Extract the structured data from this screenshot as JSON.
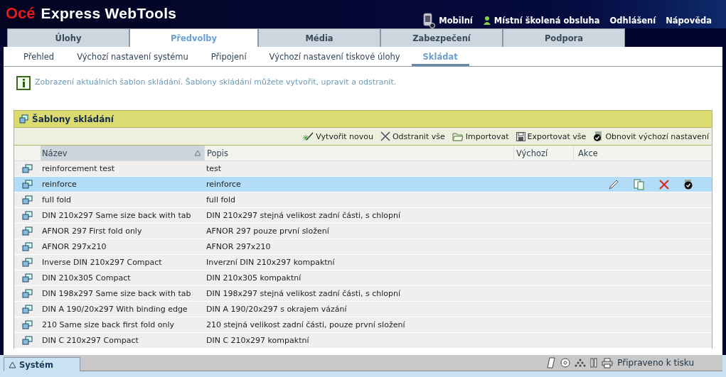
{
  "app": {
    "brand": "Océ",
    "title": "Express WebTools"
  },
  "header_links": [
    {
      "label": "Mobilní",
      "kind": "mobile"
    },
    {
      "label": "Místní školená obsluha",
      "kind": "user"
    },
    {
      "label": "Odhlášení",
      "kind": "plain"
    },
    {
      "label": "Nápověda",
      "kind": "plain"
    }
  ],
  "tabs": [
    {
      "label": "Úlohy",
      "selected": false
    },
    {
      "label": "Předvolby",
      "selected": true
    },
    {
      "label": "Média",
      "selected": false
    },
    {
      "label": "Zabezpečení",
      "selected": false
    },
    {
      "label": "Podpora",
      "selected": false
    }
  ],
  "subtabs": [
    {
      "label": "Přehled",
      "selected": false
    },
    {
      "label": "Výchozí nastavení systému",
      "selected": false
    },
    {
      "label": "Připojení",
      "selected": false
    },
    {
      "label": "Výchozí nastavení tiskové úlohy",
      "selected": false
    },
    {
      "label": "Skládat",
      "selected": true
    }
  ],
  "info": "Zobrazení aktuálních šablon skládání. Šablony skládání můžete vytvořit, upravit a odstranit.",
  "panel": {
    "title": "Šablony skládání",
    "toolbar": [
      {
        "label": "Vytvořit novou",
        "kind": "new"
      },
      {
        "label": "Odstranit vše",
        "kind": "delete"
      },
      {
        "label": "Importovat",
        "kind": "import"
      },
      {
        "label": "Exportovat vše",
        "kind": "export"
      },
      {
        "label": "Obnovit výchozí nastavení",
        "kind": "restore"
      }
    ],
    "columns": [
      "Název",
      "Popis",
      "Výchozí",
      "Akce"
    ],
    "rows": [
      {
        "name": "reinforcement test",
        "description": "test",
        "selected": false
      },
      {
        "name": "reinforce",
        "description": "reinforce",
        "selected": true
      },
      {
        "name": "full fold",
        "description": "full fold",
        "selected": false
      },
      {
        "name": "DIN 210x297 Same size back with tab",
        "description": "DIN 210x297 stejná velikost zadní části, s chlopní",
        "selected": false
      },
      {
        "name": "AFNOR 297 First fold only",
        "description": "AFNOR 297 pouze první složení",
        "selected": false
      },
      {
        "name": "AFNOR 297x210",
        "description": "AFNOR 297x210",
        "selected": false
      },
      {
        "name": "Inverse DIN 210x297 Compact",
        "description": "Inverzní DIN 210x297 kompaktní",
        "selected": false
      },
      {
        "name": "DIN 210x305 Compact",
        "description": "DIN 210x305 kompaktní",
        "selected": false
      },
      {
        "name": "DIN 198x297 Same size back with tab",
        "description": "DIN 198x297 stejná velikost zadní části, s chlopní",
        "selected": false
      },
      {
        "name": "DIN A 190/20x297 With binding edge",
        "description": "DIN A 190/20x297 s okrajem vázání",
        "selected": false
      },
      {
        "name": "210 Same size back first fold only",
        "description": "210 stejná velikost zadní části, pouze první složení",
        "selected": false
      },
      {
        "name": "DIN C 210x297 Compact",
        "description": "DIN C 210x297 kompaktní",
        "selected": false
      }
    ]
  },
  "status_bar": {
    "tab": "Systém",
    "status": "Připraveno k tisku"
  }
}
